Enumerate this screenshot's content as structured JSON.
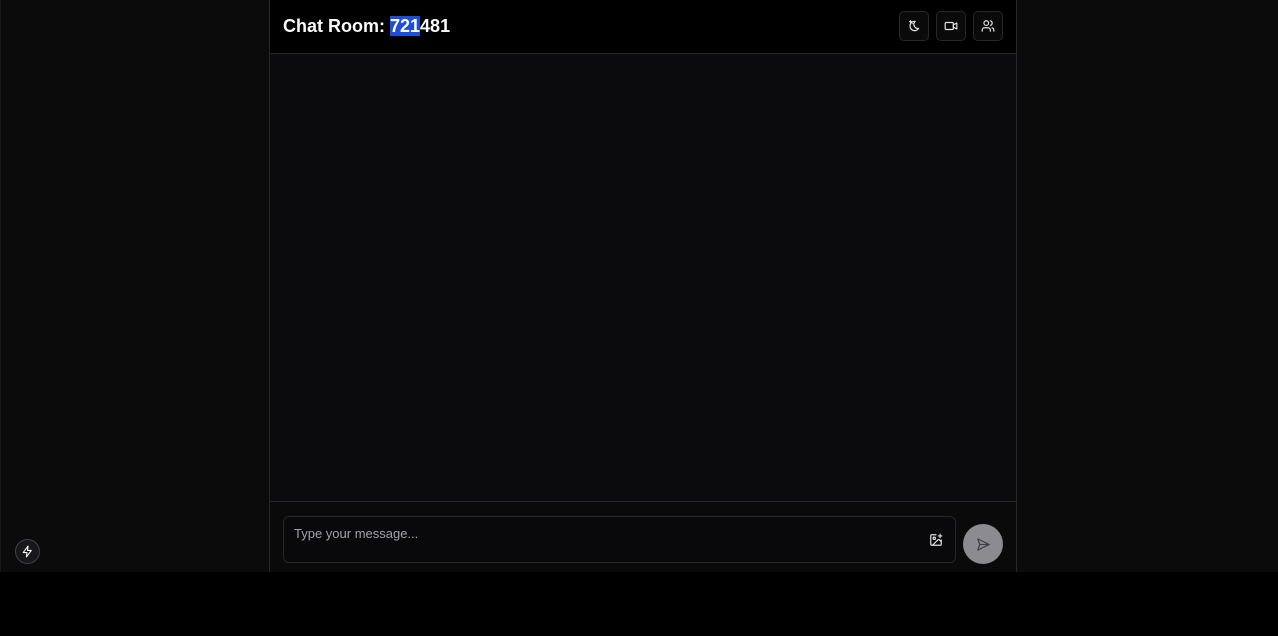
{
  "header": {
    "title_prefix": "Chat Room: ",
    "room_id_selected": "721",
    "room_id_rest": "481",
    "actions": [
      {
        "name": "theme-toggle",
        "icon": "moon-sparkle-icon"
      },
      {
        "name": "video-call",
        "icon": "video-camera-icon"
      },
      {
        "name": "participants",
        "icon": "users-icon"
      }
    ]
  },
  "composer": {
    "placeholder": "Type your message...",
    "value": "",
    "attach_icon": "image-plus-icon",
    "send_icon": "send-icon"
  },
  "floating": {
    "icon": "lightning-bolt-icon"
  },
  "colors": {
    "selection": "#1d4ed8",
    "send_button": "#8c8c90",
    "border": "#27272a"
  }
}
